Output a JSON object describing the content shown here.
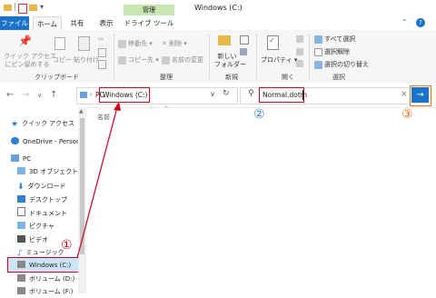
{
  "window": {
    "title": "Windows (C:)"
  },
  "tabs": {
    "file": "ファイル",
    "home": "ホーム",
    "share": "共有",
    "view": "表示",
    "context_header": "管理",
    "drive_tools": "ドライブ ツール"
  },
  "ribbon": {
    "quick_access": "クイック アクセス\nにピン留めする",
    "copy": "コピー",
    "paste": "貼り付け",
    "move_to": "移動先",
    "copy_to": "コピー先",
    "delete": "削除",
    "rename": "名前の変更",
    "new_folder": "新しい\nフォルダー",
    "properties": "プロパティ",
    "select_all": "すべて選択",
    "select_none": "選択解除",
    "invert_selection": "選択の切り替え",
    "group_clipboard": "クリップボード",
    "group_organize": "整理",
    "group_new": "新規",
    "group_open": "開く",
    "group_select": "選択"
  },
  "address": {
    "pc": "PC",
    "current": "Windows (C:)",
    "search_value": "Normal.dotm"
  },
  "column": {
    "name": "名前"
  },
  "sidebar": {
    "items": [
      {
        "label": "クイック アクセス",
        "icon": "star-icon"
      },
      {
        "label": "OneDrive - Person",
        "icon": "cloud-icon"
      },
      {
        "label": "PC",
        "icon": "pc-icon"
      },
      {
        "label": "3D オブジェクト",
        "icon": "cube-icon"
      },
      {
        "label": "ダウンロード",
        "icon": "download-icon"
      },
      {
        "label": "デスクトップ",
        "icon": "desktop-icon"
      },
      {
        "label": "ドキュメント",
        "icon": "document-icon"
      },
      {
        "label": "ピクチャ",
        "icon": "picture-icon"
      },
      {
        "label": "ビデオ",
        "icon": "video-icon"
      },
      {
        "label": "ミュージック",
        "icon": "music-icon"
      },
      {
        "label": "Windows (C:)",
        "icon": "drive-icon"
      },
      {
        "label": "ボリューム (D:)",
        "icon": "drive-icon"
      },
      {
        "label": "ボリューム (F:)",
        "icon": "drive-icon"
      }
    ]
  },
  "annotations": {
    "step1": "①",
    "step2": "②",
    "step3": "③"
  },
  "colors": {
    "accent": "#1a73c9",
    "annotation_red": "#d0021b",
    "annotation_blue": "#2f7fd1",
    "annotation_orange": "#e8731f",
    "manage_tab": "#c8e6b0"
  }
}
